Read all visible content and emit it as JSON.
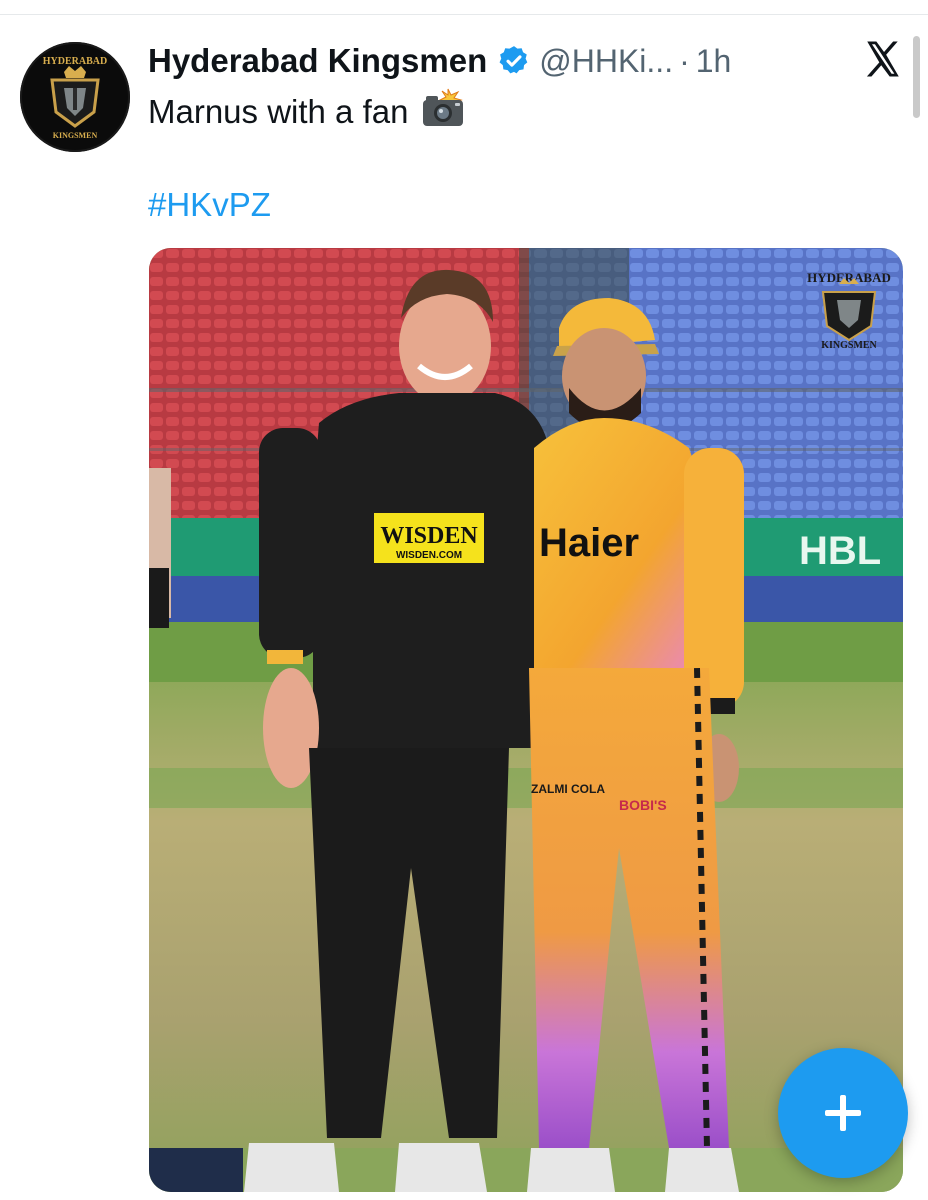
{
  "tweet": {
    "display_name": "Hyderabad Kingsmen",
    "handle": "@HHKi...",
    "separator": "·",
    "time": "1h",
    "text": "Marnus with a fan",
    "hashtag": "#HKvPZ",
    "verified": true
  },
  "avatar": {
    "top_text": "HYDERABAD",
    "bottom_text": "KINGSMEN"
  },
  "media": {
    "watermark_top": "HYDERABAD",
    "watermark_bottom": "KINGSMEN",
    "sponsor_black_shirt": "WISDEN",
    "sponsor_black_shirt_sub": "WISDEN.COM",
    "sponsor_yellow_shirt": "Haier",
    "board_text": "HBL",
    "pant_logo_1": "ZALMI COLA",
    "pant_logo_2": "BOBI'S"
  },
  "icons": {
    "platform": "x-logo-icon",
    "verified": "verified-badge-icon",
    "camera": "camera-flash-emoji-icon",
    "compose": "plus-icon"
  },
  "colors": {
    "link": "#1d9bf0",
    "secondary_text": "#536471",
    "fab": "#1d9bf0"
  }
}
